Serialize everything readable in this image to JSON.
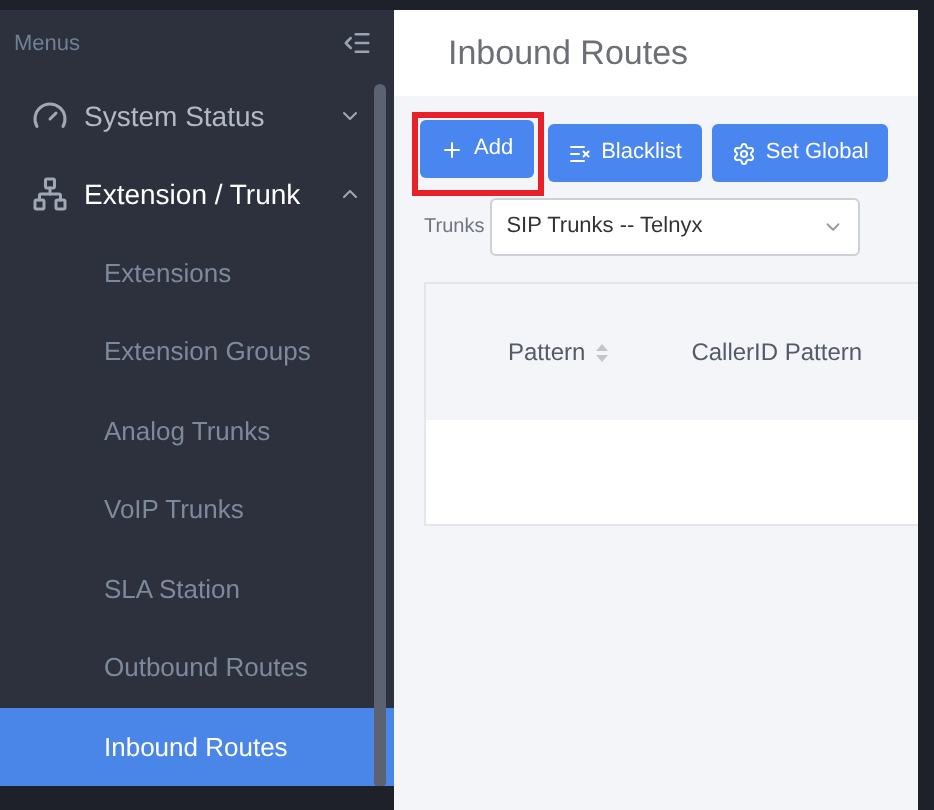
{
  "sidebar": {
    "title": "Menus",
    "groups": [
      {
        "label": "System Status",
        "expanded": false
      },
      {
        "label": "Extension / Trunk",
        "expanded": true,
        "children": [
          {
            "label": "Extensions",
            "selected": false
          },
          {
            "label": "Extension Groups",
            "selected": false
          },
          {
            "label": "Analog Trunks",
            "selected": false
          },
          {
            "label": "VoIP Trunks",
            "selected": false
          },
          {
            "label": "SLA Station",
            "selected": false
          },
          {
            "label": "Outbound Routes",
            "selected": false
          },
          {
            "label": "Inbound Routes",
            "selected": true
          }
        ]
      }
    ]
  },
  "page_title": "Inbound Routes",
  "toolbar": [
    {
      "label": "Add",
      "highlighted": true
    },
    {
      "label": "Blacklist",
      "highlighted": false
    },
    {
      "label": "Set Global",
      "highlighted": false
    }
  ],
  "trunks": {
    "label": "Trunks",
    "value": "SIP Trunks -- Telnyx"
  },
  "table": {
    "columns": [
      {
        "label": "Pattern",
        "sortable": true
      },
      {
        "label": "CallerID Pattern",
        "sortable": false
      }
    ]
  }
}
